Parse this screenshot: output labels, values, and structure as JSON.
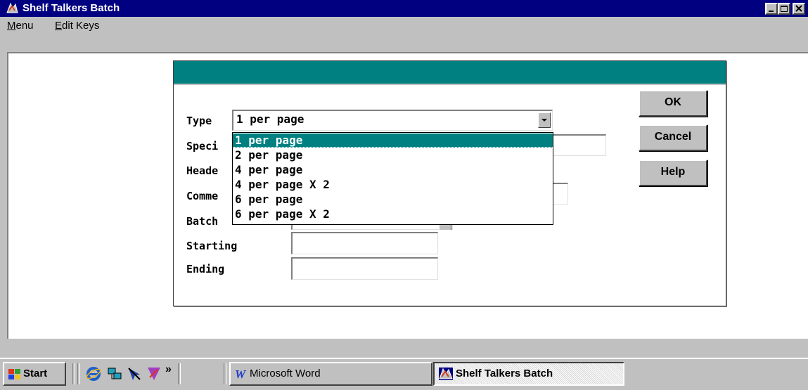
{
  "window": {
    "title": "Shelf Talkers Batch"
  },
  "menubar": {
    "items": [
      {
        "accel": "M",
        "rest": "enu"
      },
      {
        "accel": "E",
        "rest": "dit Keys"
      }
    ]
  },
  "dialog": {
    "labels": {
      "type": "Type",
      "specific": "Speci",
      "header": "Heade",
      "comment": "Comme",
      "batch": "Batch",
      "starting": "Starting",
      "ending": "Ending"
    },
    "type_combo": {
      "value": "1 per page"
    },
    "type_options": [
      "1 per page",
      "2 per page",
      "4 per page",
      "4 per page X 2",
      "6 per page",
      "6 per page X 2"
    ],
    "selected_index": 0,
    "buttons": {
      "ok": "OK",
      "cancel": "Cancel",
      "help": "Help"
    }
  },
  "taskbar": {
    "start": "Start",
    "more": "»",
    "tasks": [
      {
        "label": "Microsoft Word"
      },
      {
        "label": "Shelf Talkers Batch"
      }
    ]
  },
  "colors": {
    "titlebar": "#000080",
    "dialog_header": "#008080",
    "selection": "#008080",
    "face": "#c0c0c0"
  },
  "icons": [
    "app-icon",
    "minimize-icon",
    "maximize-icon",
    "close-icon",
    "windows-logo-icon",
    "internet-explorer-icon",
    "network-icon",
    "arrow-icon",
    "star-icon",
    "word-icon"
  ]
}
